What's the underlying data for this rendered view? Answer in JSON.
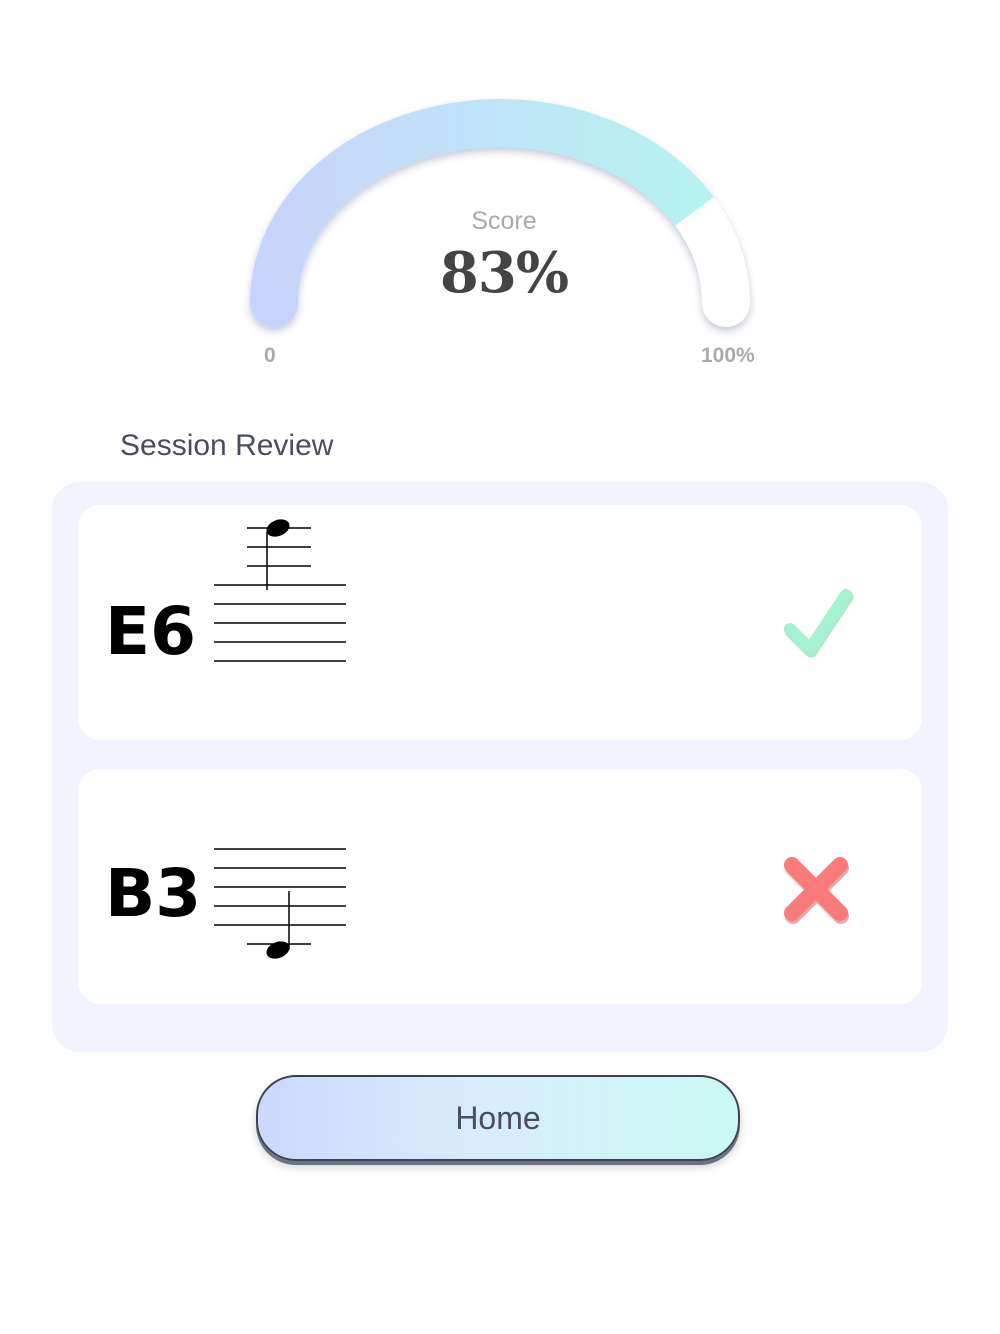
{
  "gauge": {
    "label": "Score",
    "value_text": "83%",
    "value_fraction": 0.83,
    "min_label": "0",
    "max_label": "100%",
    "colors": {
      "start": "#c6d4fb",
      "end": "#b6f3ee",
      "track": "#ffffff"
    }
  },
  "review": {
    "title": "Session Review",
    "items": [
      {
        "note": "E6",
        "result": "correct",
        "icon": "check-icon",
        "icon_color": "#9ef0c9"
      },
      {
        "note": "B3",
        "result": "incorrect",
        "icon": "cross-icon",
        "icon_color": "#fb7b7b"
      }
    ]
  },
  "home_button": {
    "label": "Home"
  }
}
